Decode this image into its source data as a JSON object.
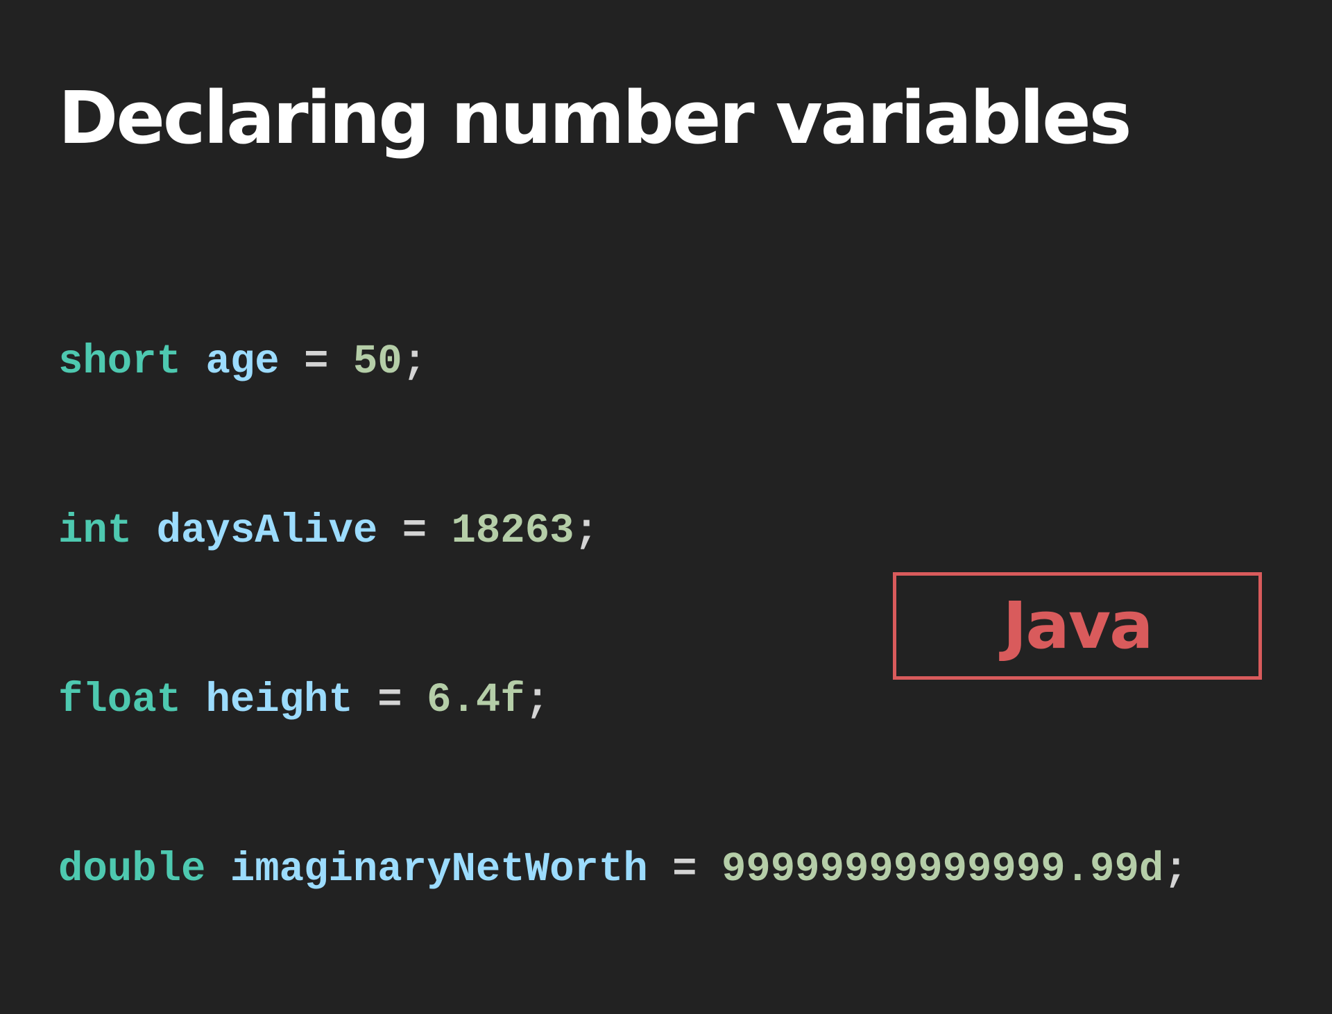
{
  "slide": {
    "title": "Declaring number variables",
    "code_lines": [
      {
        "type": "short",
        "name": "age",
        "op": "=",
        "value": "50",
        "end": ";"
      },
      {
        "type": "int",
        "name": "daysAlive",
        "op": "=",
        "value": "18263",
        "end": ";"
      },
      {
        "type": "float",
        "name": "height",
        "op": "=",
        "value": "6.4f",
        "end": ";"
      },
      {
        "type": "double",
        "name": "imaginaryNetWorth",
        "op": "=",
        "value": "99999999999999.99d",
        "end": ";"
      }
    ],
    "language_badge": "Java"
  },
  "colors": {
    "background": "#222222",
    "title": "#ffffff",
    "type_keyword": "#4ec9b0",
    "identifier": "#9cdcfe",
    "operator": "#d4d4d4",
    "number": "#b5cea8",
    "punctuation": "#d4d4d4",
    "badge": "#d95b5c"
  }
}
